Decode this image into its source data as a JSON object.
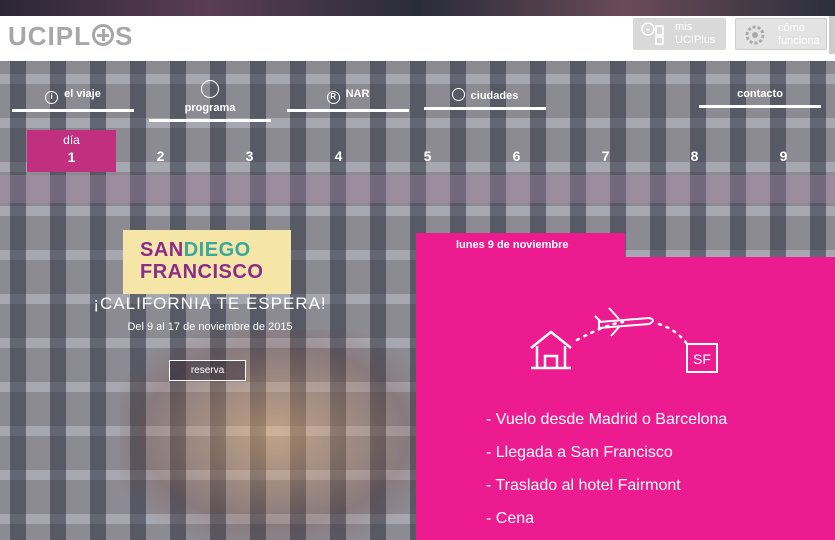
{
  "header": {
    "logo": "UCIPLUS",
    "mis_ucip": "mis UCIPlus",
    "como_funciona": "cómo funciona"
  },
  "nav": {
    "el_viaje": "el viaje",
    "programa": "programa",
    "nar": "NAR",
    "ciudades": "ciudades",
    "contacto": "contacto"
  },
  "days": {
    "label": "día",
    "numbers": [
      "1",
      "2",
      "3",
      "4",
      "5",
      "6",
      "7",
      "8",
      "9"
    ]
  },
  "promo": {
    "san": "SAN",
    "diego": "DIEGO",
    "francisco": "FRANCISCO",
    "headline": "¡CALIFORNIA TE ESPERA!",
    "dates": "Del 9 al 17 de noviembre de 2015",
    "reserva": "reserva"
  },
  "panel": {
    "date": "lunes 9 de noviembre",
    "sf_label": "SF",
    "items": [
      "- Vuelo desde Madrid o Barcelona",
      "- Llegada a San Francisco",
      "- Traslado al hotel Fairmont",
      "- Cena"
    ]
  },
  "colors": {
    "accent_pink": "#ec1c90",
    "day_active": "#c0307f",
    "logo_gray": "#a7a7a7"
  },
  "icons": [
    "user-icon",
    "gear-icon",
    "info-icon",
    "clock-icon",
    "registered-icon",
    "location-icon",
    "house-icon",
    "plane-icon"
  ]
}
